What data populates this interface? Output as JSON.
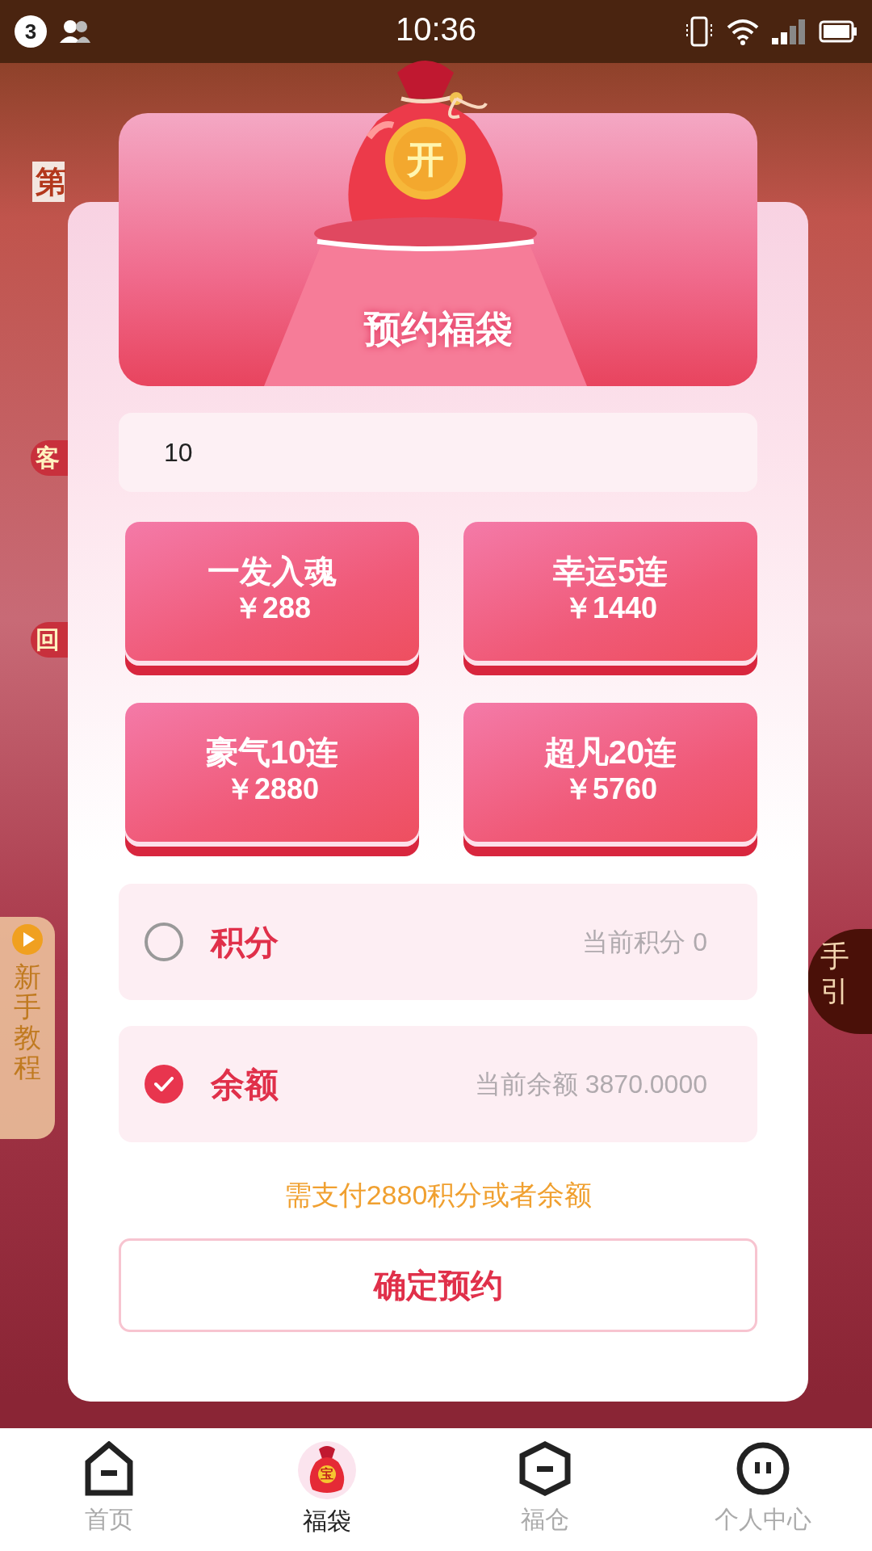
{
  "status_bar": {
    "notification_count": "3",
    "time": "10:36"
  },
  "background": {
    "banner_fragment": "第",
    "side_pills": [
      "客",
      "回"
    ],
    "tutorial_tab": {
      "label": "新手教程"
    },
    "guide_fragment": [
      "手",
      "引"
    ]
  },
  "dialog": {
    "title": "预约福袋",
    "bag_label": "开",
    "quantity_field": {
      "value": "10"
    },
    "packages": [
      {
        "name": "一发入魂",
        "price": "￥288"
      },
      {
        "name": "幸运5连",
        "price": "￥1440"
      },
      {
        "name": "豪气10连",
        "price": "￥2880"
      },
      {
        "name": "超凡20连",
        "price": "￥5760"
      }
    ],
    "payment_methods": [
      {
        "label": "积分",
        "balance": "当前积分 0",
        "selected": false
      },
      {
        "label": "余额",
        "balance": "当前余额 3870.0000",
        "selected": true
      }
    ],
    "note": "需支付2880积分或者余额",
    "confirm_button": "确定预约"
  },
  "tab_bar": [
    {
      "label": "首页",
      "kind": "home",
      "selected": false
    },
    {
      "label": "福袋",
      "kind": "bag",
      "badge": "宝",
      "selected": true
    },
    {
      "label": "福仓",
      "kind": "hexagon",
      "selected": false
    },
    {
      "label": "个人中心",
      "kind": "face",
      "selected": false
    }
  ]
}
